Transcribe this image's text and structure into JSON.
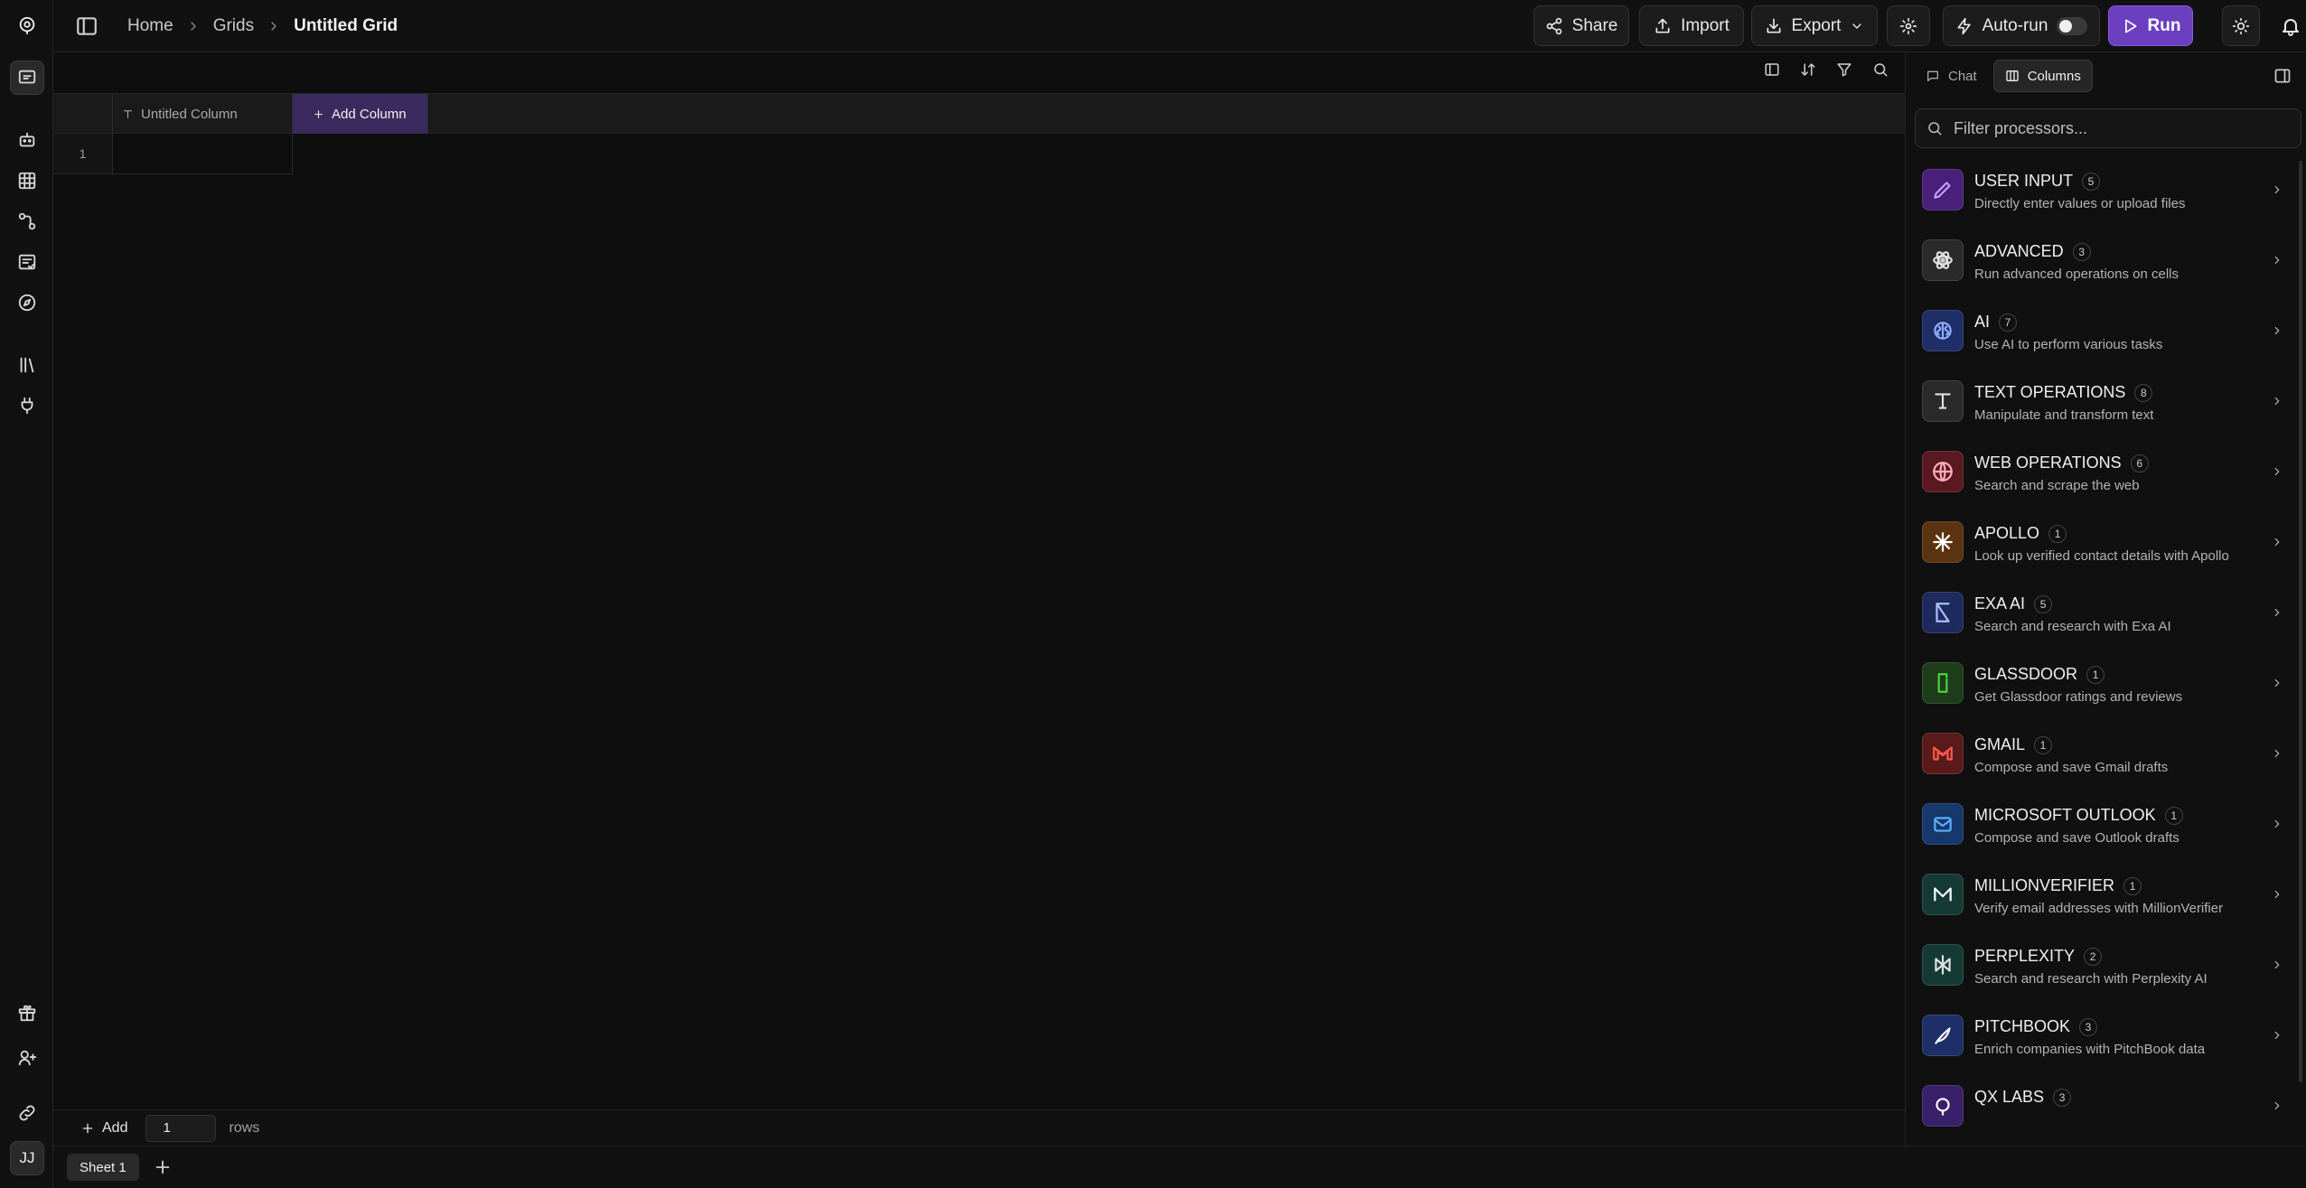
{
  "breadcrumb": {
    "home": "Home",
    "grids": "Grids",
    "current": "Untitled Grid"
  },
  "toolbar": {
    "share": "Share",
    "import": "Import",
    "export": "Export",
    "autorun": "Auto-run",
    "autorun_enabled": false,
    "run": "Run"
  },
  "grid": {
    "columns": [
      {
        "label": "Untitled Column",
        "type_icon": "text-type-icon"
      }
    ],
    "add_column": "Add Column",
    "rows": [
      {
        "index": "1",
        "cells": [
          ""
        ]
      }
    ]
  },
  "rows_bar": {
    "add": "Add",
    "count": "1",
    "label": "rows"
  },
  "sheets": [
    {
      "label": "Sheet 1",
      "active": true
    }
  ],
  "user": {
    "initials": "JJ"
  },
  "panel": {
    "tabs": [
      {
        "label": "Chat",
        "active": false
      },
      {
        "label": "Columns",
        "active": true
      }
    ],
    "filter_placeholder": "Filter processors...",
    "processors": [
      {
        "title": "USER INPUT",
        "count": "5",
        "desc": "Directly enter values or upload files",
        "icon": "pencil-icon",
        "color": "#4a1f7a"
      },
      {
        "title": "ADVANCED",
        "count": "3",
        "desc": "Run advanced operations on cells",
        "icon": "atom-icon",
        "color": "#2a2a2a"
      },
      {
        "title": "AI",
        "count": "7",
        "desc": "Use AI to perform various tasks",
        "icon": "brain-icon",
        "color": "#1e2e66"
      },
      {
        "title": "TEXT OPERATIONS",
        "count": "8",
        "desc": "Manipulate and transform text",
        "icon": "text-type-icon",
        "color": "#2a2a2a"
      },
      {
        "title": "WEB OPERATIONS",
        "count": "6",
        "desc": "Search and scrape the web",
        "icon": "globe-icon",
        "color": "#5a1820"
      },
      {
        "title": "APOLLO",
        "count": "1",
        "desc": "Look up verified contact details with Apollo",
        "icon": "apollo-icon",
        "color": "#5a3410"
      },
      {
        "title": "EXA AI",
        "count": "5",
        "desc": "Search and research with Exa AI",
        "icon": "exa-icon",
        "color": "#1e2a5e"
      },
      {
        "title": "GLASSDOOR",
        "count": "1",
        "desc": "Get Glassdoor ratings and reviews",
        "icon": "glassdoor-icon",
        "color": "#1d3d1a"
      },
      {
        "title": "GMAIL",
        "count": "1",
        "desc": "Compose and save Gmail drafts",
        "icon": "gmail-icon",
        "color": "#5a1a1a"
      },
      {
        "title": "MICROSOFT OUTLOOK",
        "count": "1",
        "desc": "Compose and save Outlook drafts",
        "icon": "outlook-icon",
        "color": "#16386a"
      },
      {
        "title": "MILLIONVERIFIER",
        "count": "1",
        "desc": "Verify email addresses with MillionVerifier",
        "icon": "millionverifier-icon",
        "color": "#153a36"
      },
      {
        "title": "PERPLEXITY",
        "count": "2",
        "desc": "Search and research with Perplexity AI",
        "icon": "perplexity-icon",
        "color": "#153a36"
      },
      {
        "title": "PITCHBOOK",
        "count": "3",
        "desc": "Enrich companies with PitchBook data",
        "icon": "pitchbook-icon",
        "color": "#1e2e66"
      },
      {
        "title": "QX LABS",
        "count": "3",
        "desc": "",
        "icon": "qx-labs-icon",
        "color": "#3a1f6a"
      }
    ]
  }
}
